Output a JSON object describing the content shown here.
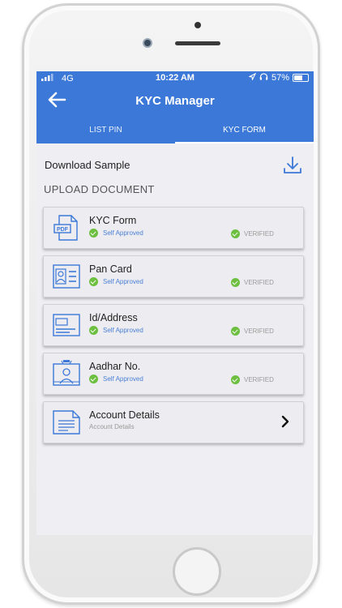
{
  "status_bar": {
    "network": "4G",
    "time": "10:22 AM",
    "battery": "57%"
  },
  "header": {
    "title": "KYC Manager"
  },
  "tabs": [
    {
      "label": "LIST PIN",
      "active": false
    },
    {
      "label": "KYC FORM",
      "active": true
    }
  ],
  "download": {
    "label": "Download Sample"
  },
  "section_title": "UPLOAD DOCUMENT",
  "documents": [
    {
      "name": "KYC Form",
      "status": "Self Approved",
      "verified": "VERIFIED",
      "icon": "pdf-file-icon"
    },
    {
      "name": "Pan Card",
      "status": "Self Approved",
      "verified": "VERIFIED",
      "icon": "pan-card-icon"
    },
    {
      "name": "Id/Address",
      "status": "Self Approved",
      "verified": "VERIFIED",
      "icon": "id-card-icon"
    },
    {
      "name": "Aadhar No.",
      "status": "Self Approved",
      "verified": "VERIFIED",
      "icon": "aadhar-icon"
    }
  ],
  "account": {
    "name": "Account Details",
    "subtitle": "Account Details",
    "icon": "document-list-icon"
  },
  "colors": {
    "primary": "#3b78d8",
    "check": "#6cbf3f",
    "link": "#4a7fd4"
  }
}
